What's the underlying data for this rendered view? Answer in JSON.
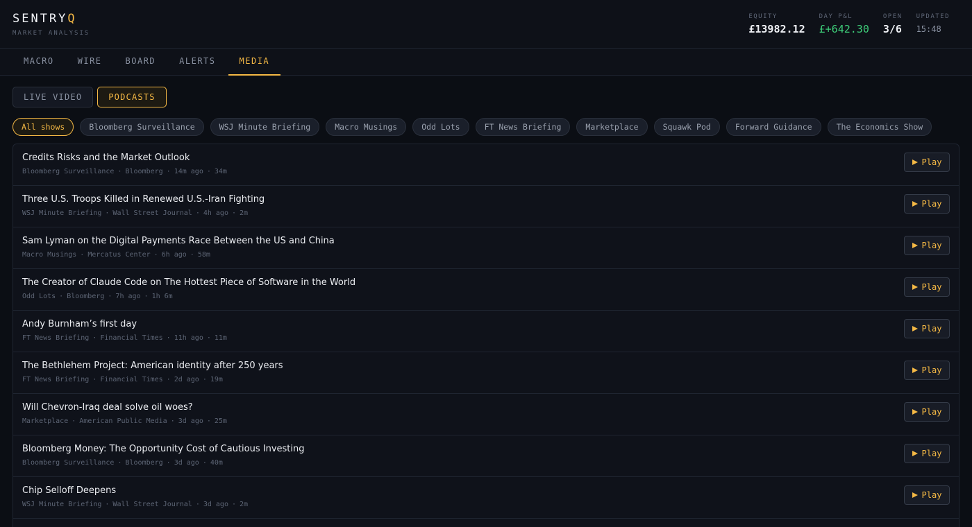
{
  "brand": {
    "name_main": "SENTRY",
    "name_accent": "Q",
    "subtitle": "MARKET ANALYSIS"
  },
  "stats": [
    {
      "label": "EQUITY",
      "value": "£13982.12"
    },
    {
      "label": "DAY P&L",
      "value": "£+642.30"
    },
    {
      "label": "OPEN",
      "value": "3/6"
    },
    {
      "label": "UPDATED",
      "value": "15:48"
    }
  ],
  "nav": {
    "tabs": [
      {
        "label": "MACRO"
      },
      {
        "label": "WIRE"
      },
      {
        "label": "BOARD"
      },
      {
        "label": "ALERTS"
      },
      {
        "label": "MEDIA"
      }
    ],
    "active": "MEDIA"
  },
  "subtabs": [
    {
      "label": "LIVE VIDEO"
    },
    {
      "label": "PODCASTS"
    }
  ],
  "filters": [
    {
      "label": "All shows"
    },
    {
      "label": "Bloomberg Surveillance"
    },
    {
      "label": "WSJ Minute Briefing"
    },
    {
      "label": "Macro Musings"
    },
    {
      "label": "Odd Lots"
    },
    {
      "label": "FT News Briefing"
    },
    {
      "label": "Marketplace"
    },
    {
      "label": "Squawk Pod"
    },
    {
      "label": "Forward Guidance"
    },
    {
      "label": "The Economics Show"
    }
  ],
  "play_label": "Play",
  "episodes": [
    {
      "title": "Credits Risks and the Market Outlook",
      "show": "Bloomberg Surveillance",
      "publisher": "Bloomberg",
      "age": "14m ago",
      "duration": "34m"
    },
    {
      "title": "Three U.S. Troops Killed in Renewed U.S.-Iran Fighting",
      "show": "WSJ Minute Briefing",
      "publisher": "Wall Street Journal",
      "age": "4h ago",
      "duration": "2m"
    },
    {
      "title": "Sam Lyman on the Digital Payments Race Between the US and China",
      "show": "Macro Musings",
      "publisher": "Mercatus Center",
      "age": "6h ago",
      "duration": "58m"
    },
    {
      "title": "The Creator of Claude Code on The Hottest Piece of Software in the World",
      "show": "Odd Lots",
      "publisher": "Bloomberg",
      "age": "7h ago",
      "duration": "1h 6m"
    },
    {
      "title": "Andy Burnham’s first day",
      "show": "FT News Briefing",
      "publisher": "Financial Times",
      "age": "11h ago",
      "duration": "11m"
    },
    {
      "title": "The Bethlehem Project: American identity after 250 years",
      "show": "FT News Briefing",
      "publisher": "Financial Times",
      "age": "2d ago",
      "duration": "19m"
    },
    {
      "title": "Will Chevron-Iraq deal solve oil woes?",
      "show": "Marketplace",
      "publisher": "American Public Media",
      "age": "3d ago",
      "duration": "25m"
    },
    {
      "title": "Bloomberg Money: The Opportunity Cost of Cautious Investing",
      "show": "Bloomberg Surveillance",
      "publisher": "Bloomberg",
      "age": "3d ago",
      "duration": "40m"
    },
    {
      "title": "Chip Selloff Deepens",
      "show": "WSJ Minute Briefing",
      "publisher": "Wall Street Journal",
      "age": "3d ago",
      "duration": "2m"
    }
  ]
}
